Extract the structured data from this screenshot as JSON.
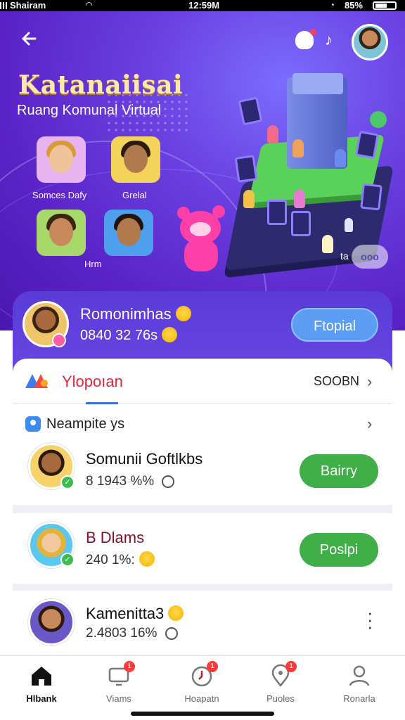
{
  "status_bar": {
    "carrier": "Shairam",
    "time": "12:59M",
    "battery": "85%"
  },
  "header": {
    "brand_title": "Katanaiisai",
    "brand_subtitle": "Ruang Komunal Virtual",
    "tiles": [
      {
        "label": "Somces Dafy"
      },
      {
        "label": "Grelal"
      },
      {
        "label": ""
      },
      {
        "label": "Hrm"
      }
    ],
    "more_button": "ooo",
    "more_text": "ta"
  },
  "profile": {
    "name": "Romonimhas",
    "stat": "0840 32 76s",
    "follow_label": "Ftopial"
  },
  "section": {
    "title": "Ylopoıan",
    "action_label": "SOOBN"
  },
  "subheader": {
    "label": "Neampite ys"
  },
  "rows": [
    {
      "name": "Somunii Goftlkbs",
      "meta": "8 1943 %%",
      "button": "Bairry"
    },
    {
      "name": "B Dlams",
      "meta": "240 1%:",
      "button": "Poslpi"
    },
    {
      "name": "Kamenitta3",
      "meta": "2.4803 16%",
      "button": ""
    }
  ],
  "bottom_nav": [
    {
      "label": "Hlbank",
      "badge": ""
    },
    {
      "label": "Viams",
      "badge": "1"
    },
    {
      "label": "Hoapatn",
      "badge": "1"
    },
    {
      "label": "Puoles",
      "badge": "1"
    },
    {
      "label": "Ronarla",
      "badge": ""
    }
  ],
  "colors": {
    "hero_purple": "#5a23c8",
    "accent_blue": "#5b9cf5",
    "accent_green": "#3fae46",
    "section_red": "#e0273a"
  }
}
